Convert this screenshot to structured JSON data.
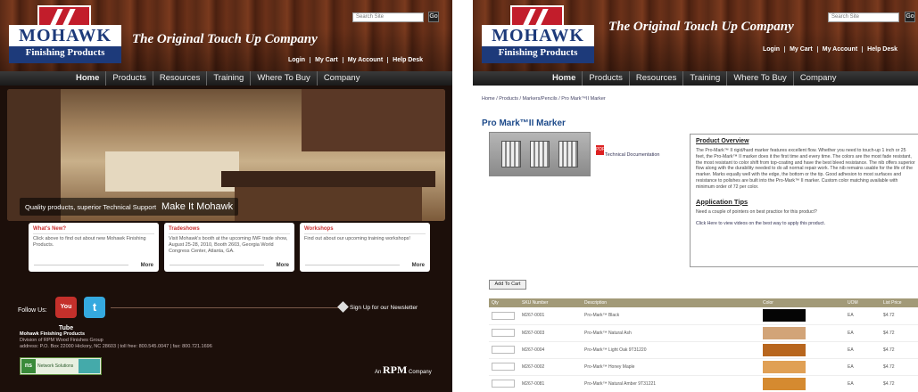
{
  "brand": {
    "name": "MOHAWK",
    "sub": "Finishing Products",
    "tagline": "The Original Touch Up Company"
  },
  "search": {
    "placeholder": "Search Site",
    "button": "Go"
  },
  "toplinks": [
    "Login",
    "My Cart",
    "My Account",
    "Help Desk"
  ],
  "nav": [
    "Home",
    "Products",
    "Resources",
    "Training",
    "Where To Buy",
    "Company"
  ],
  "hero": {
    "caption": "Quality products, superior Technical Support",
    "slogan": "Make It Mohawk"
  },
  "cards": [
    {
      "title": "What's New?",
      "body": "Click above to find out about new Mohawk Finishing Products.",
      "more": "More"
    },
    {
      "title": "Tradeshows",
      "body": "Visit Mohawk's booth at the upcoming IWF trade show, August 25-28, 2010, Booth 2603, Georgia World Congress Center, Atlanta, GA.",
      "more": "More"
    },
    {
      "title": "Workshops",
      "body": "Find out about our upcoming training workshops!",
      "more": "More"
    }
  ],
  "footer": {
    "follow": "Follow Us:",
    "youtube": "You Tube",
    "twitter": "t",
    "newsletter": "Sign Up for our Newsletter",
    "address": [
      "Mohawk Finishing Products",
      "Division of RPM Wood Finishes Group",
      "address: P.O. Box 22000 Hickory, NC 28603  |  toll free: 800.545.0047  |  fax: 800.721.1696"
    ],
    "badge_logo": "ns",
    "badge_text": "Network Solutions",
    "rpm_prefix": "An",
    "rpm": "RPM",
    "rpm_suffix": "Company"
  },
  "product": {
    "breadcrumb": "Home / Products / Markers/Pencils / Pro Mark™II Marker",
    "title": "Pro Mark™II Marker",
    "pdf_icon": "PDF",
    "techdoc": "Technical Documentation",
    "overview_title": "Product Overview",
    "overview_text": "The Pro-Mark™ II rigid/hard marker features excellent flow. Whether you need to touch-up 1 inch or 25 feet, the Pro-Mark™ II marker does it the first time and every time. The colors are the most fade resistant, the most resistant to color shift from top-coating and have the best bleed resistance. The nib offers superior flow along with the durability needed to do all normal repair work. The nib remains usable for the life of the marker. Marks equally well with the edge, the bottom or the tip. Good adhesion to most surfaces and resistance to polishes are built into the Pro-Mark™ II marker. Custom color matching available with minimum order of 72 per color.",
    "tips_title": "Application Tips",
    "tips_text": "Need a couple of pointers on best practice for this product?",
    "tips_link": "Click Here to view videos on the best way to apply this product.",
    "add_to_cart": "Add To Cart",
    "columns": [
      "Qty",
      "SKU Number",
      "Description",
      "Color",
      "UOM",
      "List Price"
    ],
    "rows": [
      {
        "sku": "M267-0001",
        "desc": "Pro-Mark™ Black",
        "color": "#050505",
        "uom": "EA",
        "price": "$4.72"
      },
      {
        "sku": "M267-0003",
        "desc": "Pro-Mark™ Natural Ash",
        "color": "#d2a478",
        "uom": "EA",
        "price": "$4.72"
      },
      {
        "sku": "M267-0004",
        "desc": "Pro-Mark™ Light Oak 9T31220",
        "color": "#b8661e",
        "uom": "EA",
        "price": "$4.72"
      },
      {
        "sku": "M267-0002",
        "desc": "Pro-Mark™ Honey Maple",
        "color": "#e0a055",
        "uom": "EA",
        "price": "$4.72"
      },
      {
        "sku": "M267-0081",
        "desc": "Pro-Mark™ Natural Amber 9T31221",
        "color": "#d58a30",
        "uom": "EA",
        "price": "$4.72"
      }
    ]
  }
}
